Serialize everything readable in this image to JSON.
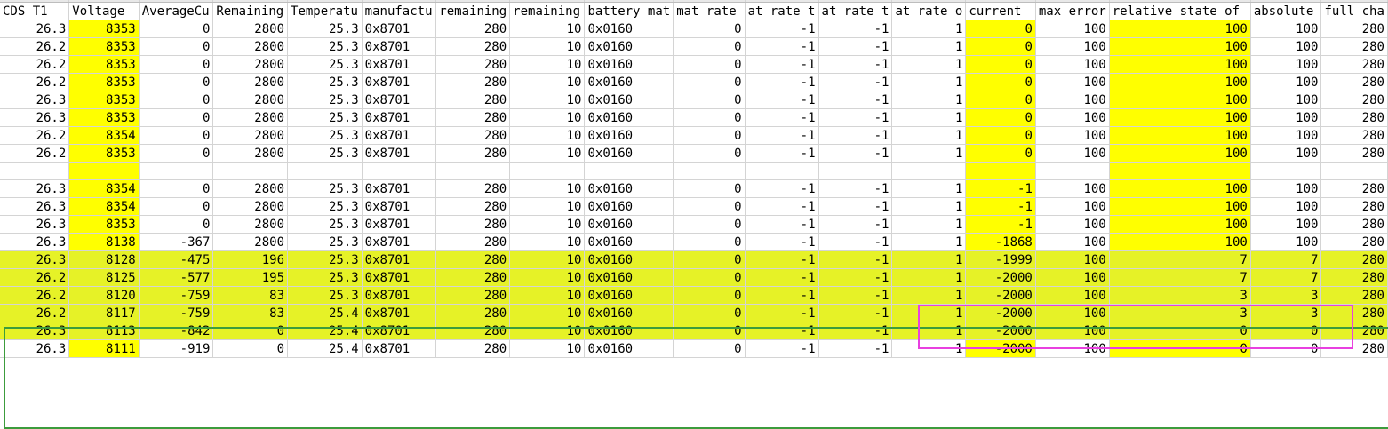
{
  "headers": [
    "CDS T1",
    "Voltage",
    "AverageCu",
    "Remaining",
    "Temperatu",
    "manufactu",
    "remaining",
    "remaining",
    "battery mat",
    "mat rate",
    "at rate t",
    "at rate t",
    "at rate o",
    "current",
    "max error",
    "relative state of",
    "absolute",
    "full cha"
  ],
  "rows": [
    {
      "type": "data",
      "hl": false,
      "cells": [
        "26.3",
        "8353",
        "0",
        "2800",
        "25.3",
        "0x8701",
        "280",
        "10",
        "0x0160",
        "0",
        "-1",
        "-1",
        "1",
        "0",
        "100",
        "100",
        "100",
        "280"
      ]
    },
    {
      "type": "data",
      "hl": false,
      "cells": [
        "26.2",
        "8353",
        "0",
        "2800",
        "25.3",
        "0x8701",
        "280",
        "10",
        "0x0160",
        "0",
        "-1",
        "-1",
        "1",
        "0",
        "100",
        "100",
        "100",
        "280"
      ]
    },
    {
      "type": "data",
      "hl": false,
      "cells": [
        "26.2",
        "8353",
        "0",
        "2800",
        "25.3",
        "0x8701",
        "280",
        "10",
        "0x0160",
        "0",
        "-1",
        "-1",
        "1",
        "0",
        "100",
        "100",
        "100",
        "280"
      ]
    },
    {
      "type": "data",
      "hl": false,
      "cells": [
        "26.2",
        "8353",
        "0",
        "2800",
        "25.3",
        "0x8701",
        "280",
        "10",
        "0x0160",
        "0",
        "-1",
        "-1",
        "1",
        "0",
        "100",
        "100",
        "100",
        "280"
      ]
    },
    {
      "type": "data",
      "hl": false,
      "cells": [
        "26.3",
        "8353",
        "0",
        "2800",
        "25.3",
        "0x8701",
        "280",
        "10",
        "0x0160",
        "0",
        "-1",
        "-1",
        "1",
        "0",
        "100",
        "100",
        "100",
        "280"
      ]
    },
    {
      "type": "data",
      "hl": false,
      "cells": [
        "26.3",
        "8353",
        "0",
        "2800",
        "25.3",
        "0x8701",
        "280",
        "10",
        "0x0160",
        "0",
        "-1",
        "-1",
        "1",
        "0",
        "100",
        "100",
        "100",
        "280"
      ]
    },
    {
      "type": "data",
      "hl": false,
      "cells": [
        "26.2",
        "8354",
        "0",
        "2800",
        "25.3",
        "0x8701",
        "280",
        "10",
        "0x0160",
        "0",
        "-1",
        "-1",
        "1",
        "0",
        "100",
        "100",
        "100",
        "280"
      ]
    },
    {
      "type": "data",
      "hl": false,
      "cells": [
        "26.2",
        "8353",
        "0",
        "2800",
        "25.3",
        "0x8701",
        "280",
        "10",
        "0x0160",
        "0",
        "-1",
        "-1",
        "1",
        "0",
        "100",
        "100",
        "100",
        "280"
      ]
    },
    {
      "type": "empty",
      "hl": false,
      "cells": [
        "",
        "",
        "",
        "",
        "",
        "",
        "",
        "",
        "",
        "",
        "",
        "",
        "",
        "",
        "",
        "",
        "",
        ""
      ]
    },
    {
      "type": "data",
      "hl": false,
      "cells": [
        "26.3",
        "8354",
        "0",
        "2800",
        "25.3",
        "0x8701",
        "280",
        "10",
        "0x0160",
        "0",
        "-1",
        "-1",
        "1",
        "-1",
        "100",
        "100",
        "100",
        "280"
      ]
    },
    {
      "type": "data",
      "hl": false,
      "cells": [
        "26.3",
        "8354",
        "0",
        "2800",
        "25.3",
        "0x8701",
        "280",
        "10",
        "0x0160",
        "0",
        "-1",
        "-1",
        "1",
        "-1",
        "100",
        "100",
        "100",
        "280"
      ]
    },
    {
      "type": "data",
      "hl": false,
      "cells": [
        "26.3",
        "8353",
        "0",
        "2800",
        "25.3",
        "0x8701",
        "280",
        "10",
        "0x0160",
        "0",
        "-1",
        "-1",
        "1",
        "-1",
        "100",
        "100",
        "100",
        "280"
      ]
    },
    {
      "type": "data",
      "hl": false,
      "cells": [
        "26.3",
        "8138",
        "-367",
        "2800",
        "25.3",
        "0x8701",
        "280",
        "10",
        "0x0160",
        "0",
        "-1",
        "-1",
        "1",
        "-1868",
        "100",
        "100",
        "100",
        "280"
      ]
    },
    {
      "type": "data",
      "hl": true,
      "cells": [
        "26.3",
        "8128",
        "-475",
        "196",
        "25.3",
        "0x8701",
        "280",
        "10",
        "0x0160",
        "0",
        "-1",
        "-1",
        "1",
        "-1999",
        "100",
        "7",
        "7",
        "280"
      ]
    },
    {
      "type": "data",
      "hl": true,
      "cells": [
        "26.2",
        "8125",
        "-577",
        "195",
        "25.3",
        "0x8701",
        "280",
        "10",
        "0x0160",
        "0",
        "-1",
        "-1",
        "1",
        "-2000",
        "100",
        "7",
        "7",
        "280"
      ]
    },
    {
      "type": "data",
      "hl": true,
      "cells": [
        "26.2",
        "8120",
        "-759",
        "83",
        "25.3",
        "0x8701",
        "280",
        "10",
        "0x0160",
        "0",
        "-1",
        "-1",
        "1",
        "-2000",
        "100",
        "3",
        "3",
        "280"
      ]
    },
    {
      "type": "data",
      "hl": true,
      "cells": [
        "26.2",
        "8117",
        "-759",
        "83",
        "25.4",
        "0x8701",
        "280",
        "10",
        "0x0160",
        "0",
        "-1",
        "-1",
        "1",
        "-2000",
        "100",
        "3",
        "3",
        "280"
      ]
    },
    {
      "type": "data",
      "hl": true,
      "cells": [
        "26.3",
        "8113",
        "-842",
        "0",
        "25.4",
        "0x8701",
        "280",
        "10",
        "0x0160",
        "0",
        "-1",
        "-1",
        "1",
        "-2000",
        "100",
        "0",
        "0",
        "280"
      ]
    },
    {
      "type": "data",
      "hl": false,
      "cells": [
        "26.3",
        "8111",
        "-919",
        "0",
        "25.4",
        "0x8701",
        "280",
        "10",
        "0x0160",
        "0",
        "-1",
        "-1",
        "1",
        "-2000",
        "100",
        "0",
        "0",
        "280"
      ]
    }
  ],
  "colors": {
    "column_highlight": "#ffff00",
    "row_highlight": "#e6f227",
    "selection_border": "#3c9c3c",
    "annotation_border": "#e840e0"
  }
}
